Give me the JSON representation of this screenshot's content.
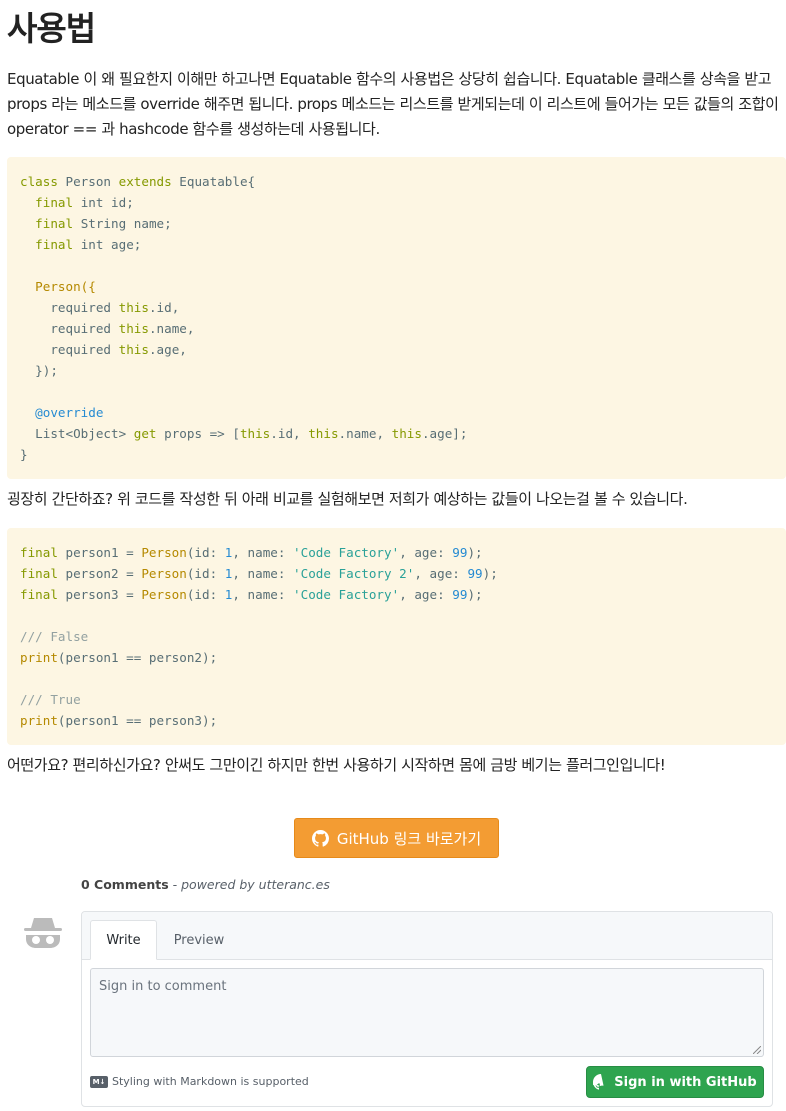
{
  "article": {
    "title": "사용법",
    "para1": "Equatable 이 왜 필요한지 이해만 하고나면 Equatable 함수의 사용법은 상당히 쉽습니다. Equatable 클래스를 상속을 받고 props 라는 메소드를 override 해주면 됩니다. props 메소드는 리스트를 받게되는데 이 리스트에 들어가는 모든 값들의 조합이 operator == 과 hashcode 함수를 생성하는데 사용됩니다.",
    "para2": "굉장히 간단하죠? 위 코드를 작성한 뒤 아래 비교를 실험해보면 저희가 예상하는 값들이 나오는걸 볼 수 있습니다.",
    "para3": "어떤가요? 편리하신가요? 안써도 그만이긴 하지만 한번 사용하기 시작하면 몸에 금방 베기는 플러그인입니다!"
  },
  "code1": {
    "kw_class": "class",
    "name_person": "Person",
    "kw_extends": "extends",
    "name_equatable": "Equatable{",
    "kw_final": "final",
    "t_int": "int",
    "f_id": "id;",
    "t_string": "String",
    "f_name": "name;",
    "f_age": "age;",
    "ctor_open": "Person({",
    "req": "required",
    "kw_this": "this",
    "p_id": ".id,",
    "p_name": ".name,",
    "p_age": ".age,",
    "ctor_close": "});",
    "annotation": "@override",
    "list_type": "List<Object>",
    "kw_get": "get",
    "props": "props => [",
    "r_id": ".id, ",
    "r_name": ".name, ",
    "r_age": ".age];",
    "close": "}"
  },
  "code2": {
    "kw_final": "final",
    "v1": "person1 = ",
    "v2": "person2 = ",
    "v3": "person3 = ",
    "ctor": "Person",
    "args_a": "(id: ",
    "one": "1",
    "args_b": ", name: ",
    "s1": "'Code Factory'",
    "s2": "'Code Factory 2'",
    "args_c": ", age: ",
    "ninetynine": "99",
    "end": ");",
    "comment_false": "/// False",
    "comment_true": "/// True",
    "print": "print",
    "cmp1": "(person1 == person2);",
    "cmp2": "(person1 == person3);"
  },
  "github_button": {
    "label": "GitHub 링크 바로가기"
  },
  "comments": {
    "count": "0 Comments",
    "powered": " - powered by utteranc.es",
    "tab_write": "Write",
    "tab_preview": "Preview",
    "placeholder": "Sign in to comment",
    "markdown_badge": "M↓",
    "markdown_note": "Styling with Markdown is supported",
    "signin_label": "Sign in with GitHub"
  }
}
